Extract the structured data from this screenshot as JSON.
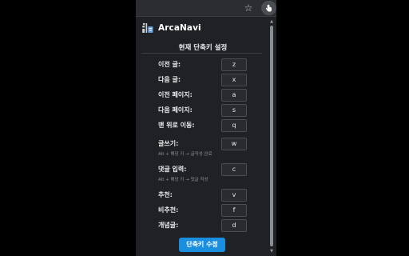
{
  "toolbar": {
    "star_icon": "star-icon",
    "extension_icon": "hand-pointer-icon"
  },
  "app": {
    "title": "ArcaNavi"
  },
  "section": {
    "title": "현재 단축키 설정"
  },
  "shortcuts": [
    {
      "label": "이전 글:",
      "key": "z"
    },
    {
      "label": "다음 글:",
      "key": "x"
    },
    {
      "label": "이전 페이지:",
      "key": "a"
    },
    {
      "label": "다음 페이지:",
      "key": "s"
    },
    {
      "label": "맨 위로 이동:",
      "key": "q"
    },
    {
      "label": "글쓰기:",
      "key": "w",
      "hint": "Alt + 해당 키 → 글작성 완료"
    },
    {
      "label": "댓글 입력:",
      "key": "c",
      "hint": "Alt + 해당 키 → 댓글 작성"
    },
    {
      "label": "추천:",
      "key": "v"
    },
    {
      "label": "비추천:",
      "key": "f"
    },
    {
      "label": "개념글:",
      "key": "d"
    }
  ],
  "actions": {
    "edit_label": "단축키 수정"
  },
  "colors": {
    "popup_background": "#202124",
    "accent": "#1a8fe0",
    "text": "#e8eaed",
    "hint_text": "#8a8d93"
  }
}
